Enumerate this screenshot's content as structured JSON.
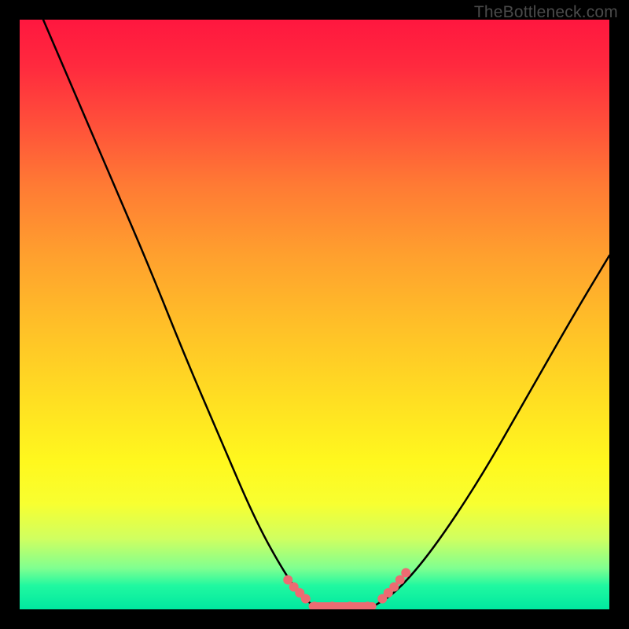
{
  "attribution": "TheBottleneck.com",
  "chart_data": {
    "type": "line",
    "title": "",
    "xlabel": "",
    "ylabel": "",
    "xlim": [
      0,
      1
    ],
    "ylim": [
      0,
      1
    ],
    "series": [
      {
        "name": "left-curve",
        "x": [
          0.04,
          0.1,
          0.16,
          0.22,
          0.28,
          0.34,
          0.4,
          0.45,
          0.48,
          0.5
        ],
        "values": [
          1.0,
          0.86,
          0.72,
          0.58,
          0.43,
          0.29,
          0.15,
          0.06,
          0.02,
          0.005
        ]
      },
      {
        "name": "flat-bottom",
        "x": [
          0.5,
          0.6
        ],
        "values": [
          0.005,
          0.005
        ]
      },
      {
        "name": "right-curve",
        "x": [
          0.6,
          0.64,
          0.7,
          0.78,
          0.86,
          0.94,
          1.0
        ],
        "values": [
          0.005,
          0.03,
          0.1,
          0.22,
          0.36,
          0.5,
          0.6
        ]
      }
    ],
    "markers": {
      "left_cluster": {
        "x": [
          0.455,
          0.465,
          0.475,
          0.485
        ],
        "y": [
          0.05,
          0.038,
          0.028,
          0.018
        ]
      },
      "bottom_points": {
        "x": [
          0.5,
          0.53,
          0.56,
          0.59
        ],
        "y": [
          0.005,
          0.005,
          0.005,
          0.005
        ]
      },
      "right_cluster": {
        "x": [
          0.615,
          0.625,
          0.635,
          0.645,
          0.655
        ],
        "y": [
          0.018,
          0.028,
          0.038,
          0.05,
          0.062
        ]
      }
    },
    "marker_color": "#ec6b72",
    "line_color": "#000000"
  }
}
